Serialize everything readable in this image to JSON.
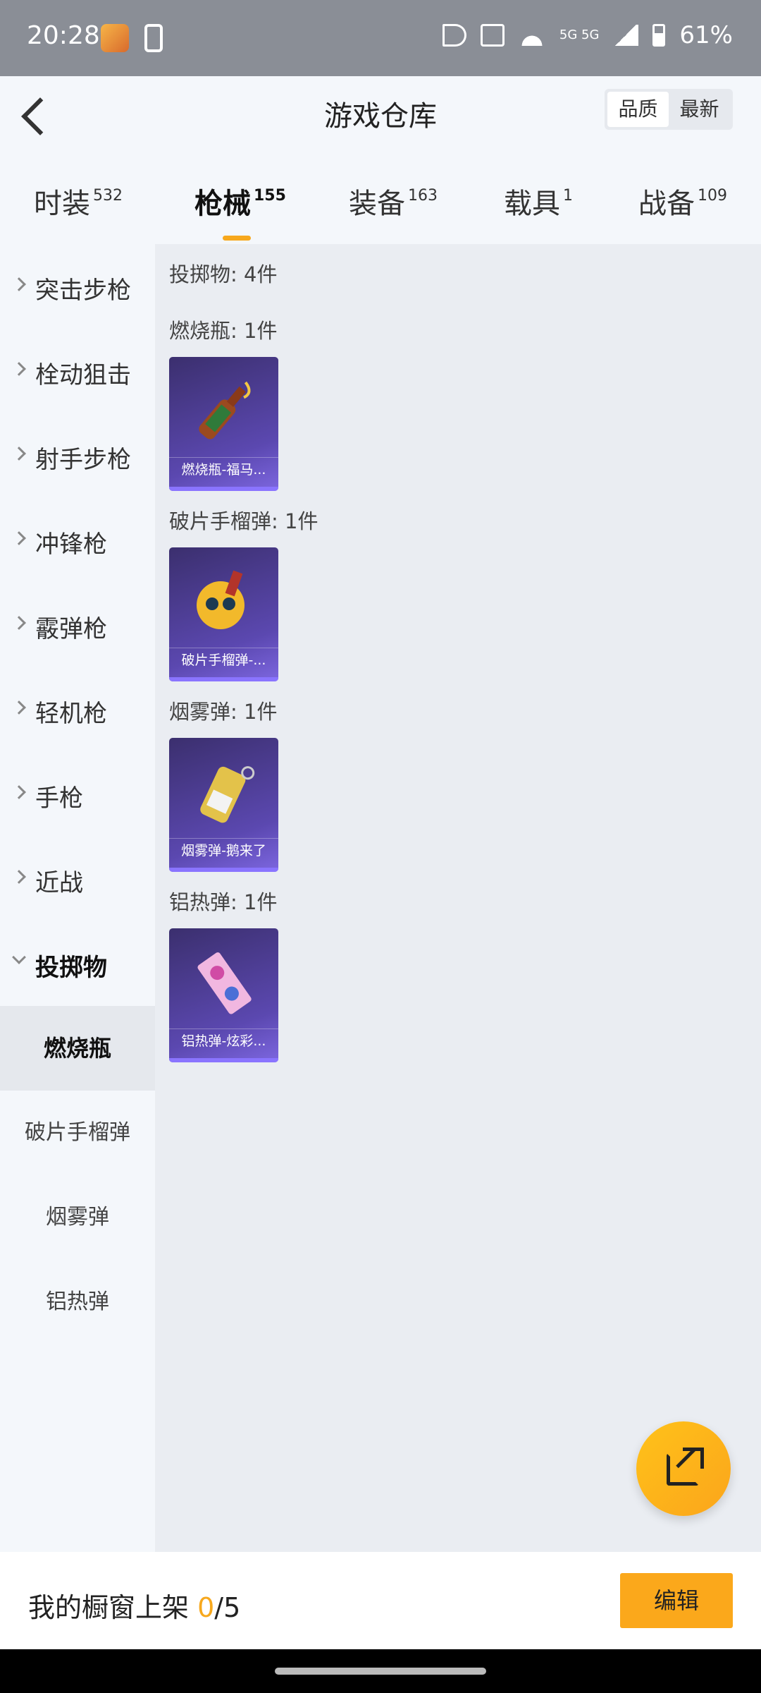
{
  "status_bar": {
    "time": "20:28",
    "network": "5G 5G",
    "battery": "61%"
  },
  "header": {
    "title": "游戏仓库",
    "sort_options": [
      "品质",
      "最新"
    ]
  },
  "tabs": [
    {
      "label": "时装",
      "count": "532"
    },
    {
      "label": "枪械",
      "count": "155"
    },
    {
      "label": "装备",
      "count": "163"
    },
    {
      "label": "载具",
      "count": "1"
    },
    {
      "label": "战备",
      "count": "109"
    }
  ],
  "sidebar": {
    "categories": [
      "突击步枪",
      "栓动狙击",
      "射手步枪",
      "冲锋枪",
      "霰弹枪",
      "轻机枪",
      "手枪",
      "近战",
      "投掷物"
    ],
    "subcategories": [
      "燃烧瓶",
      "破片手榴弹",
      "烟雾弹",
      "铝热弹"
    ]
  },
  "main": {
    "summary": "投掷物: 4件",
    "groups": [
      {
        "heading": "燃烧瓶: 1件",
        "item_name": "燃烧瓶-福马...",
        "icon": "molotov-icon"
      },
      {
        "heading": "破片手榴弹: 1件",
        "item_name": "破片手榴弹-...",
        "icon": "grenade-icon"
      },
      {
        "heading": "烟雾弹: 1件",
        "item_name": "烟雾弹-鹅来了",
        "icon": "smoke-grenade-icon"
      },
      {
        "heading": "铝热弹: 1件",
        "item_name": "铝热弹-炫彩...",
        "icon": "thermite-icon"
      }
    ]
  },
  "bottom_bar": {
    "label": "我的橱窗上架",
    "count": "0",
    "total": "/5",
    "edit_label": "编辑"
  },
  "colors": {
    "accent": "#fba81b",
    "card_bg": "#5b48b0"
  }
}
